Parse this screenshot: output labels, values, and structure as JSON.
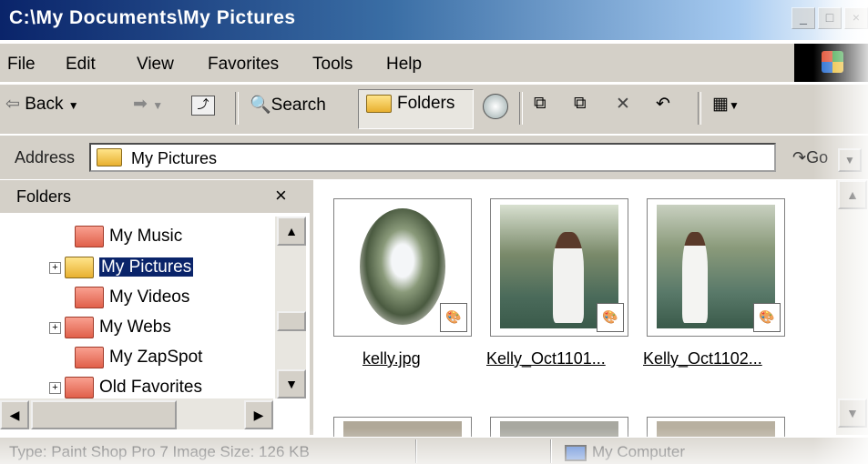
{
  "window": {
    "title": "C:\\My Documents\\My Pictures",
    "minimize": "_",
    "maximize": "□",
    "close": "×"
  },
  "menu": {
    "items": [
      "File",
      "Edit",
      "View",
      "Favorites",
      "Tools",
      "Help"
    ]
  },
  "toolbar": {
    "back": "Back",
    "search": "Search",
    "folders": "Folders"
  },
  "address": {
    "label": "Address",
    "value": "My Pictures",
    "go": "Go"
  },
  "folders_pane": {
    "title": "Folders",
    "close": "×",
    "items": [
      {
        "label": "My Music",
        "expandable": false,
        "selected": false
      },
      {
        "label": "My Pictures",
        "expandable": true,
        "selected": true
      },
      {
        "label": "My Videos",
        "expandable": false,
        "selected": false
      },
      {
        "label": "My Webs",
        "expandable": true,
        "selected": false
      },
      {
        "label": "My ZapSpot",
        "expandable": false,
        "selected": false
      },
      {
        "label": "Old Favorites",
        "expandable": true,
        "selected": false
      }
    ]
  },
  "files": [
    {
      "name": "kelly.jpg"
    },
    {
      "name": "Kelly_Oct1101..."
    },
    {
      "name": "Kelly_Oct1102..."
    }
  ],
  "status": {
    "text": "Type: Paint Shop Pro 7 Image Size: 126 KB",
    "zone": "My Computer"
  },
  "colors": {
    "titlebar": "#0a246a",
    "selection": "#0a246a",
    "chrome": "#d4d0c8"
  }
}
